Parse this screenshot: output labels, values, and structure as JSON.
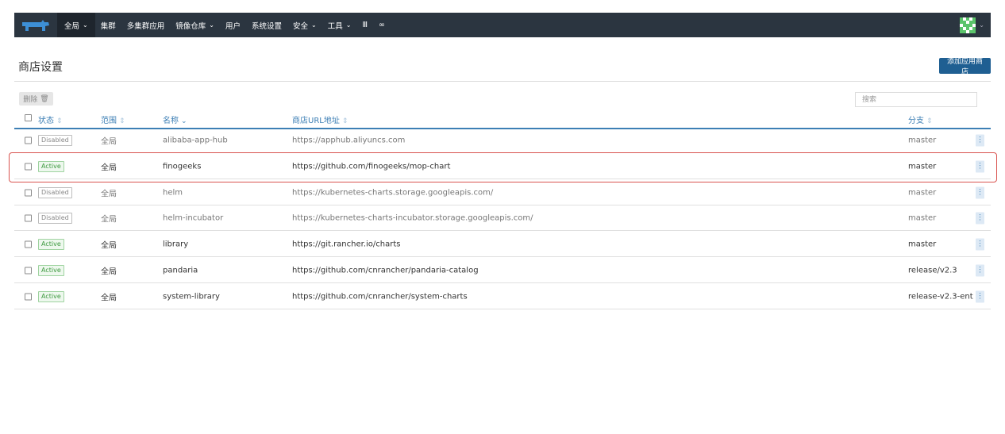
{
  "nav": {
    "items": [
      {
        "label": "全局",
        "dropdown": true,
        "active": true
      },
      {
        "label": "集群",
        "dropdown": false
      },
      {
        "label": "多集群应用",
        "dropdown": false
      },
      {
        "label": "镜像仓库",
        "dropdown": true
      },
      {
        "label": "用户",
        "dropdown": false
      },
      {
        "label": "系统设置",
        "dropdown": false
      },
      {
        "label": "安全",
        "dropdown": true
      },
      {
        "label": "工具",
        "dropdown": true
      },
      {
        "label": "Ⅲ",
        "dropdown": false
      },
      {
        "label": "∞",
        "dropdown": false
      }
    ]
  },
  "page": {
    "title": "商店设置",
    "add_button": "添加应用商店",
    "delete_button": "删除",
    "search_placeholder": "搜索"
  },
  "table": {
    "headers": {
      "status": "状态",
      "scope": "范围",
      "name": "名称",
      "url": "商店URL地址",
      "branch": "分支"
    },
    "rows": [
      {
        "status": "Disabled",
        "scope": "全局",
        "name": "alibaba-app-hub",
        "url": "https://apphub.aliyuncs.com",
        "branch": "master"
      },
      {
        "status": "Active",
        "scope": "全局",
        "name": "finogeeks",
        "url": "https://github.com/finogeeks/mop-chart",
        "branch": "master"
      },
      {
        "status": "Disabled",
        "scope": "全局",
        "name": "helm",
        "url": "https://kubernetes-charts.storage.googleapis.com/",
        "branch": "master"
      },
      {
        "status": "Disabled",
        "scope": "全局",
        "name": "helm-incubator",
        "url": "https://kubernetes-charts-incubator.storage.googleapis.com/",
        "branch": "master"
      },
      {
        "status": "Active",
        "scope": "全局",
        "name": "library",
        "url": "https://git.rancher.io/charts",
        "branch": "master"
      },
      {
        "status": "Active",
        "scope": "全局",
        "name": "pandaria",
        "url": "https://github.com/cnrancher/pandaria-catalog",
        "branch": "release/v2.3"
      },
      {
        "status": "Active",
        "scope": "全局",
        "name": "system-library",
        "url": "https://github.com/cnrancher/system-charts",
        "branch": "release-v2.3-ent"
      }
    ]
  },
  "colors": {
    "navbar": "#2b3540",
    "accent": "#3d7fb5",
    "primary_button": "#1f5f92",
    "highlight": "#d9534f"
  },
  "icons": [
    "rancher-logo-icon",
    "chevron-down-icon",
    "trash-icon",
    "sort-icon",
    "kebab-icon",
    "user-avatar-icon"
  ]
}
